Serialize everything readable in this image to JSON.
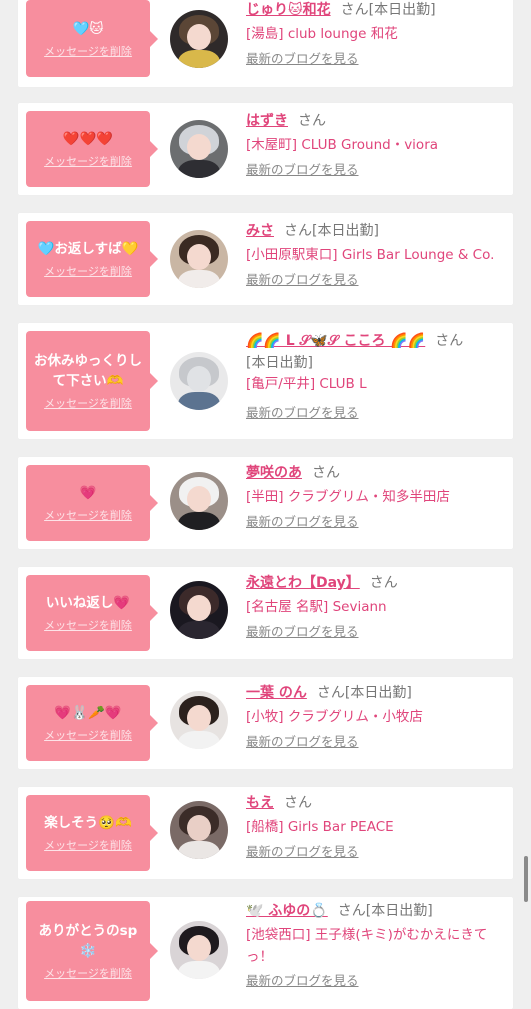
{
  "delete_label": "メッセージを削除",
  "blog_label": "最新のブログを見る",
  "san_label": "さん",
  "today_label": "[本日出勤]",
  "colors": {
    "accent": "#e0457b",
    "bubble": "#f78e9e",
    "background": "#efefef"
  },
  "items": [
    {
      "message": "🩵🐱",
      "name": "じゅり🐱和花",
      "today": true,
      "shop": "[湯島] club lounge 和花",
      "avatar_icon": "avatar-photo"
    },
    {
      "message": "❤️❤️❤️",
      "name": "はずき",
      "today": false,
      "shop": "[木屋町] CLUB Ground・viora",
      "avatar_icon": "avatar-photo"
    },
    {
      "message": "🩵お返しすば💛",
      "name": "みさ",
      "today": true,
      "shop": "[小田原駅東口] Girls Bar Lounge & Co.",
      "avatar_icon": "avatar-photo"
    },
    {
      "message": "お休みゆっくりして下さい🫶",
      "name": "🌈🌈 L 𝒮🦋𝒮 こころ 🌈🌈",
      "today": true,
      "shop": "[亀戸/平井] CLUB L",
      "avatar_icon": "avatar-photo"
    },
    {
      "message": "💗",
      "name": "夢咲のあ",
      "today": false,
      "shop": "[半田] クラブグリム・知多半田店",
      "avatar_icon": "avatar-photo"
    },
    {
      "message": "いいね返し💗",
      "name": "永遠とわ【Day】",
      "today": false,
      "shop": "[名古屋 名駅] Seviann",
      "avatar_icon": "avatar-photo"
    },
    {
      "message": "💗🐰🥕💗",
      "name": "一葉 のん",
      "today": true,
      "shop": "[小牧] クラブグリム・小牧店",
      "avatar_icon": "avatar-photo"
    },
    {
      "message": "楽しそう🥺🫶",
      "name": "もえ",
      "today": false,
      "shop": "[船橋] Girls Bar PEACE",
      "avatar_icon": "avatar-photo"
    },
    {
      "message": "ありがとうのsp❄️",
      "name": "🕊️ ふゆの💍",
      "today": true,
      "shop": "[池袋西口] 王子様(キミ)がむかえにきてっ！",
      "avatar_icon": "avatar-photo"
    }
  ]
}
